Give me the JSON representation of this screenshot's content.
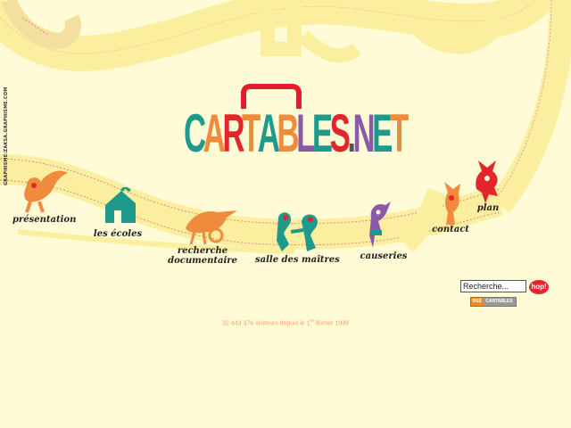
{
  "logo": {
    "text": "CARTABLES.NET",
    "letters": [
      "C",
      "A",
      "R",
      "T",
      "A",
      "B",
      "L",
      "E",
      "S",
      ".",
      "N",
      "E",
      "T"
    ],
    "letter_colors": [
      "#1d9a8b",
      "#f08a3c",
      "#e3262b",
      "#f08a3c",
      "#1d9a8b",
      "#f08a3c",
      "#8a5aa8",
      "#1d9a8b",
      "#e3262b",
      "#555555",
      "#8a5aa8",
      "#1d9a8b",
      "#f08a3c"
    ],
    "handle_color": "#e31d2d"
  },
  "side_credit": "GRAPHISME:ZAKSA.GRAPHISME.COM",
  "nav": {
    "presentation": "présentation",
    "ecoles": "les écoles",
    "recherche_line1": "recherche",
    "recherche_line2": "documentaire",
    "salle": "salle des maîtres",
    "causeries": "causeries",
    "contact": "contact",
    "plan": "plan"
  },
  "search": {
    "value": "Recherche...",
    "button_label": "hop!"
  },
  "rss": {
    "left": "RSS",
    "right": "CARTABLES"
  },
  "counter": {
    "number": "32 443 376",
    "text_before": "visiteurs depuis le 1",
    "sup": "er",
    "text_after": "février 1999"
  },
  "colors": {
    "background": "#fffbd6",
    "path": "#fbee9e",
    "orange": "#f08a3c",
    "teal": "#1d9a8b",
    "red": "#e3262b",
    "purple": "#8a5aa8"
  }
}
